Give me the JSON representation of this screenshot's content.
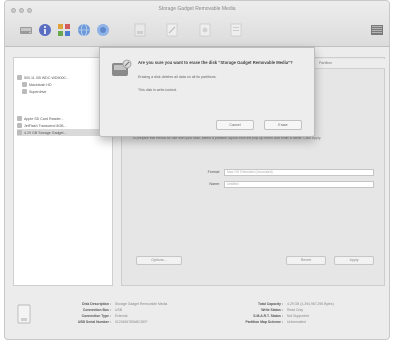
{
  "window": {
    "title": "Storage Gadget Removable Media"
  },
  "toolbar": {
    "icons": [
      "harddisk-icon",
      "info-icon",
      "apps-icon",
      "globe-icon",
      "globe-blue-icon",
      "doc-icon",
      "edit-icon",
      "stamp-icon",
      "doc-alt-icon",
      "log-icon"
    ]
  },
  "sidebar": {
    "items": [
      {
        "label": "500.11 GB WDC WD5000...",
        "selected": false
      },
      {
        "label": "Macintosh HD",
        "selected": false
      },
      {
        "label": "Superdrive",
        "selected": false
      },
      {
        "label": "Apple SD Card Reader...",
        "selected": false
      },
      {
        "label": "JetFlash Transcend 8GB...",
        "selected": false
      },
      {
        "label": "4.29 GB Storage Gadget...",
        "selected": true
      }
    ]
  },
  "main": {
    "tab_partition": "Partition",
    "hint": "To prepare this media for use with your Mac, select a partition layout from the pop-up menu and enter a name. Click Apply.",
    "name_label": "Format:",
    "name_value": "Mac OS Extended (Journaled)",
    "size_label": "Name:",
    "size_value": "Untitled",
    "options_button": "Options...",
    "revert_button": "Revert",
    "apply_button": "Apply"
  },
  "sheet": {
    "title": "Are you sure you want to erase the disk “Storage Gadget Removable Media”?",
    "line1": "Erasing a disk deletes all data on all its partitions.",
    "line2": "This disk is write-locked.",
    "cancel_button": "Cancel",
    "erase_button": "Erase"
  },
  "footer": {
    "left": [
      {
        "key": "Disk Description :",
        "value": "Storage Gadget Removable Media"
      },
      {
        "key": "Connection Bus :",
        "value": "USB"
      },
      {
        "key": "Connection Type :",
        "value": "External"
      },
      {
        "key": "USB Serial Number :",
        "value": "0123456789ABCDEF"
      }
    ],
    "right": [
      {
        "key": "Total Capacity :",
        "value": "4.29 GB (4,294,967,296 Bytes)"
      },
      {
        "key": "Write Status :",
        "value": "Read Only"
      },
      {
        "key": "S.M.A.R.T. Status :",
        "value": "Not Supported"
      },
      {
        "key": "Partition Map Scheme :",
        "value": "Unformatted"
      }
    ]
  }
}
